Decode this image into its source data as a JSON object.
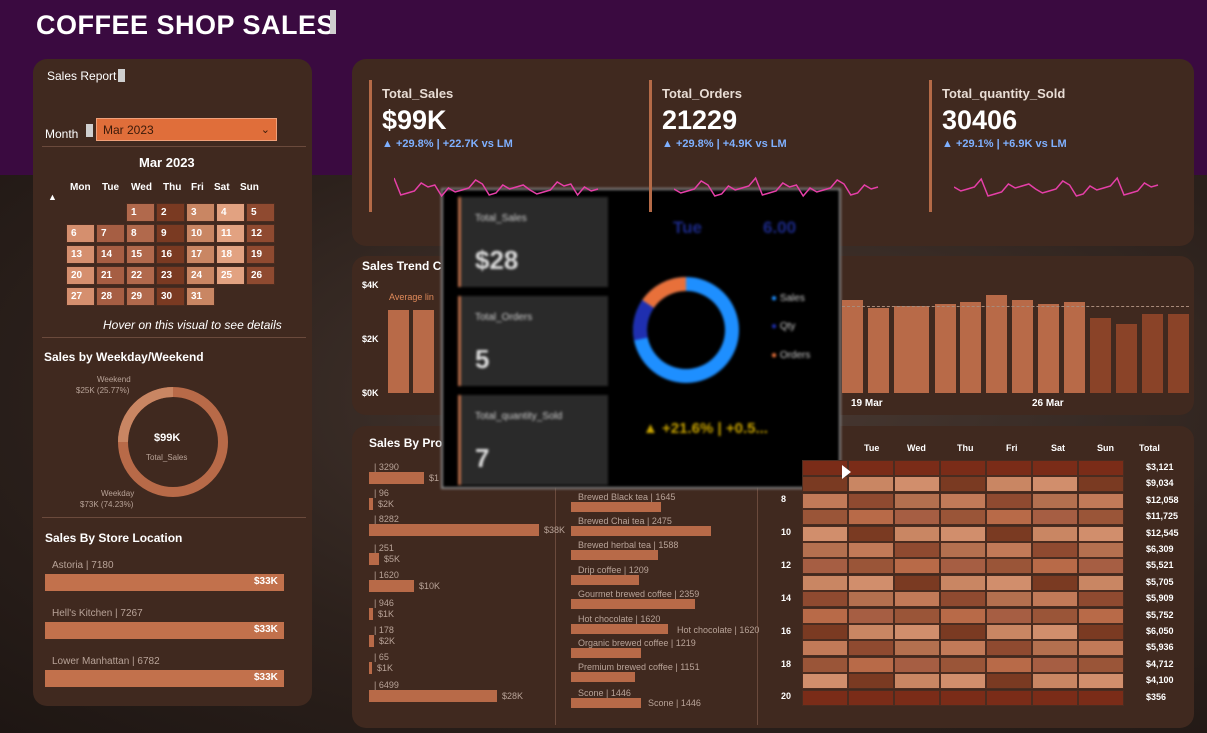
{
  "header": {
    "title": "COFFEE SHOP SALES"
  },
  "left": {
    "sales_report_label": "Sales Report",
    "month_label": "Month",
    "month_value": "Mar 2023",
    "calendar_title": "Mar 2023",
    "weekdays": [
      "Mon",
      "Tue",
      "Wed",
      "Thu",
      "Fri",
      "Sat",
      "Sun"
    ],
    "hover_hint": "Hover on this visual to see details",
    "weekday_title": "Sales by Weekday/Weekend",
    "donut_center": "$99K",
    "donut_sub": "Total_Sales",
    "weekend_label": "Weekend",
    "weekend_value": "$25K (25.77%)",
    "weekday_label": "Weekday",
    "weekday_value": "$73K (74.23%)",
    "store_title": "Sales By Store Location",
    "stores": [
      {
        "name": "Astoria | 7180",
        "value": "$33K"
      },
      {
        "name": "Hell's Kitchen | 7267",
        "value": "$33K"
      },
      {
        "name": "Lower Manhattan | 6782",
        "value": "$33K"
      }
    ]
  },
  "kpis": [
    {
      "label": "Total_Sales",
      "value": "$99K",
      "delta": "▲ +29.8% | +22.7K vs LM"
    },
    {
      "label": "Total_Orders",
      "value": "21229",
      "delta": "▲ +29.8% | +4.9K vs LM"
    },
    {
      "label": "Total_quantity_Sold",
      "value": "30406",
      "delta": "▲ +29.1% | +6.9K vs LM"
    }
  ],
  "trend": {
    "title": "Sales Trend C",
    "y_ticks": [
      "$4K",
      "$2K",
      "$0K"
    ],
    "average_label": "Average lin",
    "x_ticks": [
      "19 Mar",
      "26 Mar"
    ]
  },
  "products": {
    "title": "Sales By Prod",
    "left_labels": [
      "| 3290",
      "| 96",
      "| 8282",
      "| 251",
      "| 1620",
      "| 946",
      "| 178",
      "| 65",
      "| 6499"
    ],
    "left_values": [
      "$1",
      "$2K",
      "$38K",
      "$5K",
      "$10K",
      "$1K",
      "$2K",
      "$1K",
      "$28K"
    ],
    "right_labels": [
      "Brewed Black tea | 1645",
      "Brewed Chai tea | 2475",
      "Brewed herbal tea | 1588",
      "Drip coffee | 1209",
      "Gourmet brewed coffee | 2359",
      "Hot chocolate | 1620",
      "Organic brewed coffee | 1219",
      "Premium brewed coffee | 1151",
      "Scone | 1446"
    ],
    "hot_chocolate_callout": "Hot chocolate | 1620",
    "scone_callout": "Scone | 1446"
  },
  "heatmap": {
    "days": [
      "Tue",
      "Wed",
      "Thu",
      "Fri",
      "Sat",
      "Sun"
    ],
    "total_label": "Total",
    "hours": [
      "8",
      "10",
      "12",
      "14",
      "16",
      "18",
      "20"
    ],
    "totals": [
      "$3,121",
      "$9,034",
      "$12,058",
      "$11,725",
      "$12,545",
      "$6,309",
      "$5,521",
      "$5,705",
      "$5,909",
      "$5,752",
      "$6,050",
      "$5,936",
      "$4,712",
      "$4,100",
      "$356"
    ]
  },
  "tooltip": {
    "cards": [
      {
        "label": "Total_Sales",
        "value": "$28"
      },
      {
        "label": "Total_Orders",
        "value": "5"
      },
      {
        "label": "Total_quantity_Sold",
        "value": "7"
      }
    ],
    "day": "Tue",
    "hour": "6.00",
    "legend": [
      "Sales",
      "Qty",
      "Orders"
    ],
    "delta": "▲ +21.6% | +0.5..."
  },
  "colors": {
    "accent": "#e06e3a",
    "kpi_spark": "#e63fa8",
    "bar": "#b86a48",
    "delta": "#7fb0ff"
  }
}
